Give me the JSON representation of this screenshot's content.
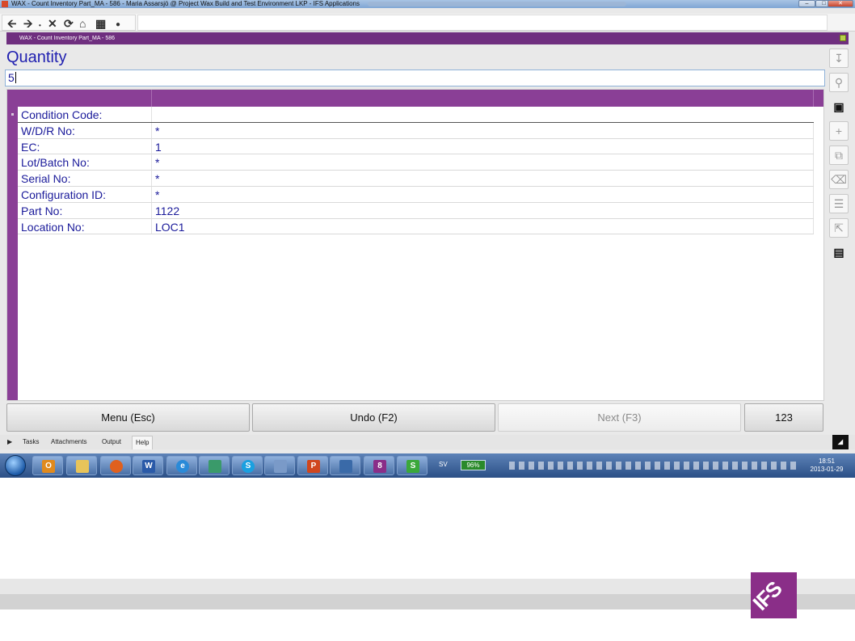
{
  "window": {
    "title": "WAX - Count Inventory Part_MA - 586 - Maria  Assarsjö @ Project Wax Build and Test Environment LKP - IFS Applications",
    "buttons": [
      "–",
      "□",
      "✕"
    ]
  },
  "nav": {
    "icons": [
      "back-arrow-icon",
      "forward-arrow-icon",
      "close-x-icon",
      "refresh-icon",
      "home-icon",
      "grid-icon",
      "dot-icon"
    ]
  },
  "header": {
    "title": "WAX - Count Inventory Part_MA - 586"
  },
  "field": {
    "label": "Quantity",
    "value": "5"
  },
  "table": {
    "rows": [
      {
        "label": "Condition Code:",
        "value": ""
      },
      {
        "label": "W/D/R No:",
        "value": "*"
      },
      {
        "label": "EC:",
        "value": "1"
      },
      {
        "label": "Lot/Batch No:",
        "value": "*"
      },
      {
        "label": "Serial No:",
        "value": "*"
      },
      {
        "label": "Configuration ID:",
        "value": "*"
      },
      {
        "label": "Part No:",
        "value": "1122"
      },
      {
        "label": "Location No:",
        "value": "LOC1"
      }
    ]
  },
  "right_toolbar": {
    "icons": [
      "download-icon",
      "search-icon",
      "save-icon",
      "add-icon",
      "copy-icon",
      "delete-icon",
      "list-icon",
      "resize-icon",
      "details-icon"
    ]
  },
  "buttons": {
    "menu": "Menu (Esc)",
    "undo": "Undo (F2)",
    "next": "Next (F3)",
    "keypad": "123"
  },
  "tabs": [
    "Tasks",
    "Attachments",
    "Output",
    "Help"
  ],
  "taskbar": {
    "apps": [
      "O",
      "",
      "",
      "W",
      "e",
      "",
      "S",
      "",
      "P",
      "",
      "8",
      "S"
    ],
    "language": "SV",
    "battery": "96%",
    "time": "18:51",
    "date": "2013-01-29"
  },
  "logo": {
    "text": "IFS"
  }
}
